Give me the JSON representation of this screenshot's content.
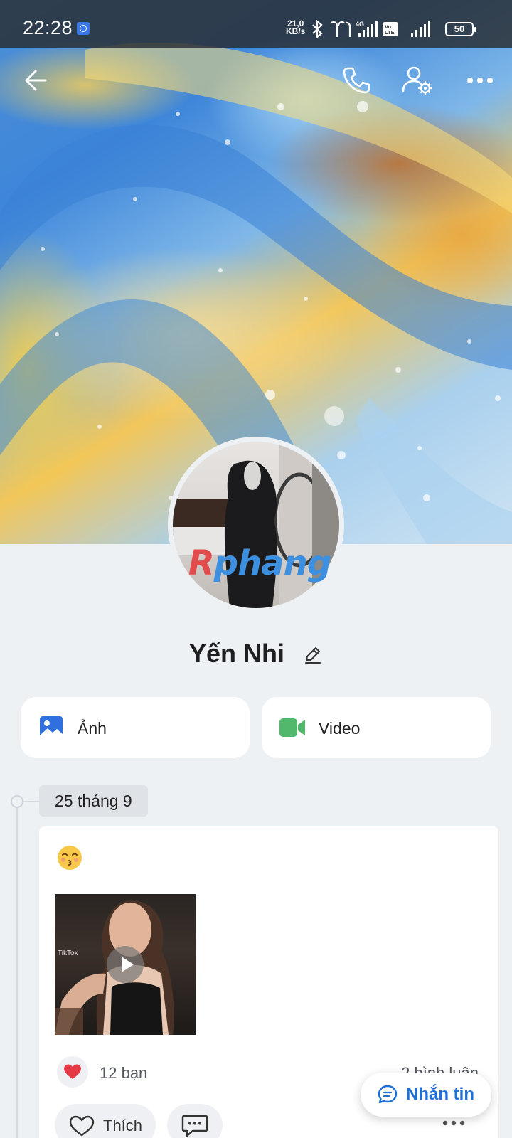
{
  "status_bar": {
    "time": "22:28",
    "net_speed_value": "21,0",
    "net_speed_unit": "KB/s",
    "network_type": "4G",
    "volte_label": "Vo LTE",
    "battery": "50"
  },
  "nav": {
    "back_icon": "arrow-left-icon",
    "call_icon": "phone-icon",
    "profile_settings_icon": "user-gear-icon",
    "more_icon": "more-horizontal-icon"
  },
  "profile": {
    "name": "Yến Nhi",
    "watermark_part1": "R",
    "watermark_part2": "phang"
  },
  "media": {
    "photos_label": "Ảnh",
    "videos_label": "Video",
    "photos_color": "#2f6fde",
    "videos_color": "#52b86c"
  },
  "timeline": {
    "date": "25 tháng 9",
    "post": {
      "emoji": "kissing-face",
      "thumbnail_watermark": "TikTok",
      "reactions_count": "12 bạn",
      "comments_count": "2 bình luận",
      "like_label": "Thích"
    }
  },
  "fab": {
    "message_label": "Nhắn tin",
    "accent": "#1f6fd8"
  }
}
